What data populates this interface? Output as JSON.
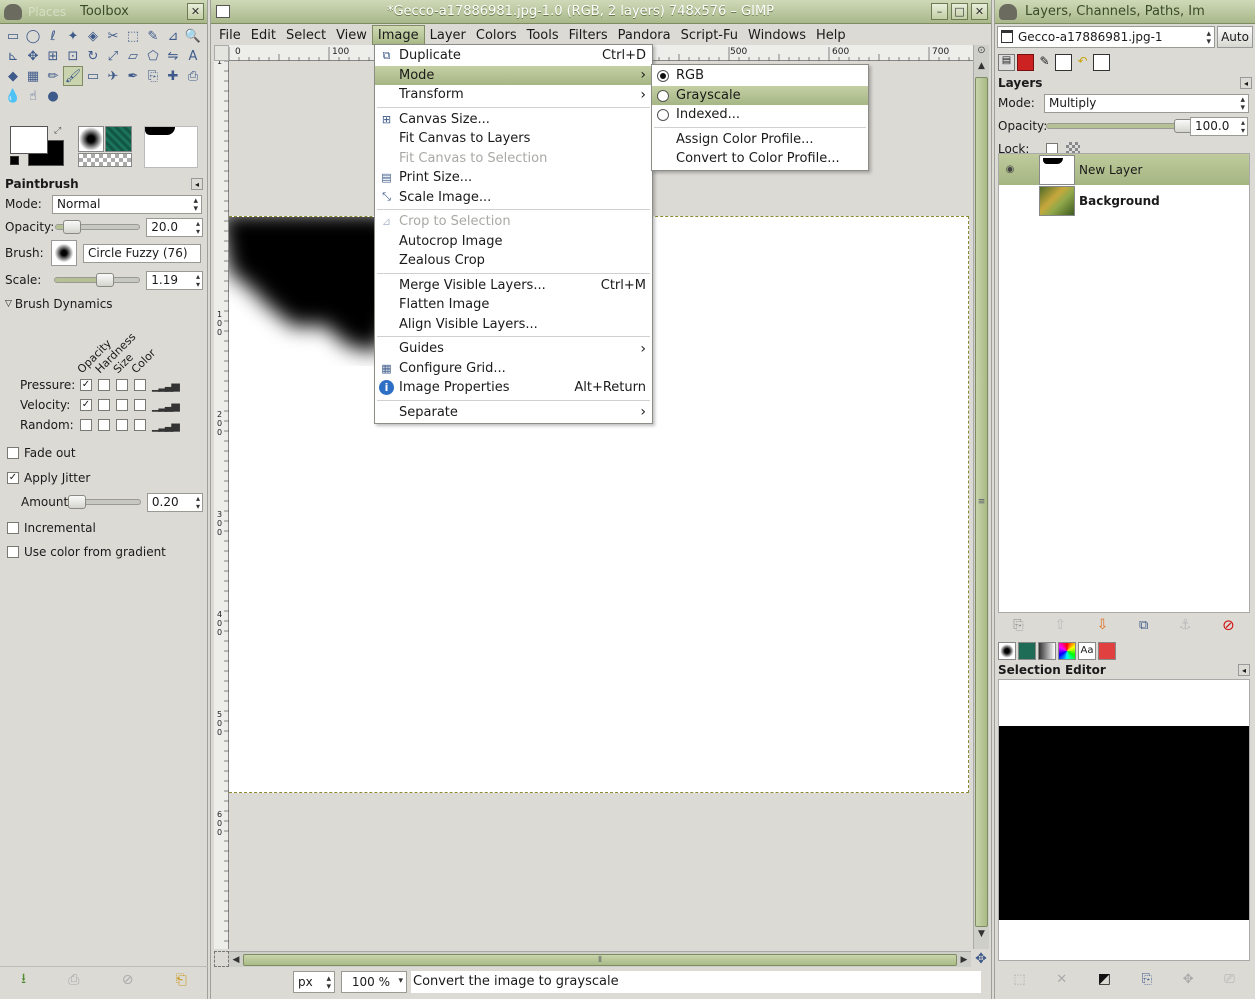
{
  "toolbox": {
    "title": "Toolbox",
    "title_ghost": "Places",
    "tool_icons": [
      "rect-select-icon",
      "ellipse-select-icon",
      "lasso-icon",
      "fuzzy-select-icon",
      "color-select-icon",
      "scissors-icon",
      "foreground-select-icon",
      "paths-icon",
      "color-picker-icon",
      "zoom-icon",
      "measure-icon",
      "move-icon",
      "align-icon",
      "crop-icon",
      "rotate-icon",
      "scale-icon",
      "shear-icon",
      "perspective-icon",
      "flip-icon",
      "text-icon",
      "bucket-fill-icon",
      "blend-icon",
      "pencil-icon",
      "paintbrush-icon",
      "eraser-icon",
      "airbrush-icon",
      "ink-icon",
      "clone-icon",
      "heal-icon",
      "perspective-clone-icon",
      "blur-icon",
      "smudge-icon",
      "dodge-burn-icon"
    ],
    "tool_glyphs": [
      "▭",
      "◯",
      "ℓ",
      "✦",
      "◈",
      "✂",
      "⬚",
      "✎",
      "⊿",
      "🔍",
      "⊾",
      "✥",
      "⊞",
      "⊡",
      "↻",
      "⤢",
      "▱",
      "⬠",
      "⇋",
      "A",
      "◆",
      "▦",
      "✏",
      "🖌",
      "▭",
      "✈",
      "✒",
      "⎘",
      "✚",
      "⎙",
      "💧",
      "☝",
      "●"
    ],
    "tool_option": {
      "name": "Paintbrush",
      "mode_label": "Mode:",
      "mode_value": "Normal",
      "opacity_label": "Opacity:",
      "opacity_value": "20.0",
      "opacity_fraction": 0.2,
      "brush_label": "Brush:",
      "brush_value": "Circle Fuzzy (76)",
      "scale_label": "Scale:",
      "scale_value": "1.19",
      "scale_fraction": 0.59,
      "dynamics_label": "Brush Dynamics",
      "dyn_cols": [
        "Opacity",
        "Hardness",
        "Size",
        "Color"
      ],
      "dyn_rows": [
        {
          "label": "Pressure:",
          "checks": [
            true,
            false,
            false,
            false
          ]
        },
        {
          "label": "Velocity:",
          "checks": [
            true,
            false,
            false,
            false
          ]
        },
        {
          "label": "Random:",
          "checks": [
            false,
            false,
            false,
            false
          ]
        }
      ],
      "fade_out": "Fade out",
      "apply_jitter": "Apply Jitter",
      "amount_label": "Amount:",
      "amount_value": "0.20",
      "amount_fraction": 0.05,
      "incremental": "Incremental",
      "use_gradient": "Use color from gradient"
    }
  },
  "image_window": {
    "title": "*Gecco-a17886981.jpg-1.0 (RGB, 2 layers) 748x576 – GIMP",
    "menus": [
      "File",
      "Edit",
      "Select",
      "View",
      "Image",
      "Layer",
      "Colors",
      "Tools",
      "Filters",
      "Pandora",
      "Script-Fu",
      "Windows",
      "Help"
    ],
    "ruler_ticks": [
      "0",
      "100",
      "500",
      "600",
      "700"
    ],
    "vruler_ticks": [
      "1",
      "1 0 0",
      "2 0 0",
      "3 0 0",
      "4 0 0",
      "5 0 0",
      "6 0 0"
    ],
    "status": {
      "unit": "px",
      "zoom": "100 %",
      "message": "Convert the image to grayscale"
    }
  },
  "image_menu": {
    "items": [
      {
        "label": "Duplicate",
        "shortcut": "Ctrl+D",
        "icon": "duplicate-icon",
        "glyph": "⧉"
      },
      {
        "label": "Mode",
        "submenu": true,
        "highlight": true
      },
      {
        "label": "Transform",
        "submenu": true
      },
      {
        "sep": true
      },
      {
        "label": "Canvas Size...",
        "icon": "canvas-size-icon",
        "glyph": "⊞"
      },
      {
        "label": "Fit Canvas to Layers"
      },
      {
        "label": "Fit Canvas to Selection",
        "disabled": true
      },
      {
        "label": "Print Size...",
        "icon": "print-size-icon",
        "glyph": "▤"
      },
      {
        "label": "Scale Image...",
        "icon": "scale-image-icon",
        "glyph": "⤡"
      },
      {
        "sep": true
      },
      {
        "label": "Crop to Selection",
        "disabled": true,
        "icon": "crop-icon",
        "glyph": "⊿"
      },
      {
        "label": "Autocrop Image"
      },
      {
        "label": "Zealous Crop"
      },
      {
        "sep": true
      },
      {
        "label": "Merge Visible Layers...",
        "shortcut": "Ctrl+M"
      },
      {
        "label": "Flatten Image"
      },
      {
        "label": "Align Visible Layers..."
      },
      {
        "sep": true
      },
      {
        "label": "Guides",
        "submenu": true
      },
      {
        "label": "Configure Grid...",
        "icon": "grid-icon",
        "glyph": "▦"
      },
      {
        "label": "Image Properties",
        "shortcut": "Alt+Return",
        "icon": "info-icon",
        "glyph": "i"
      },
      {
        "sep": true
      },
      {
        "label": "Separate",
        "submenu": true
      }
    ]
  },
  "mode_submenu": {
    "items": [
      {
        "label": "RGB",
        "radio": true,
        "checked": true
      },
      {
        "label": "Grayscale",
        "radio": true,
        "checked": false,
        "highlight": true
      },
      {
        "label": "Indexed...",
        "radio": true,
        "checked": false
      },
      {
        "sep": true
      },
      {
        "label": "Assign Color Profile..."
      },
      {
        "label": "Convert to Color Profile..."
      }
    ]
  },
  "layers_dock": {
    "title": "Layers, Channels, Paths, Im",
    "image_select": "Gecco-a17886981.jpg-1",
    "auto_label": "Auto",
    "panel_title": "Layers",
    "mode_label": "Mode:",
    "mode_value": "Multiply",
    "opacity_label": "Opacity:",
    "opacity_value": "100.0",
    "opacity_fraction": 1.0,
    "lock_label": "Lock:",
    "layers": [
      {
        "name": "New Layer",
        "selected": true,
        "visible": true
      },
      {
        "name": "Background",
        "selected": false,
        "visible": false
      }
    ],
    "selection_editor_title": "Selection Editor"
  },
  "colors": {
    "accent": "#a8b888",
    "menu_highlight": "#b4c295",
    "canvas_bg": "#ffffff",
    "workspace": "#dcdad5"
  }
}
